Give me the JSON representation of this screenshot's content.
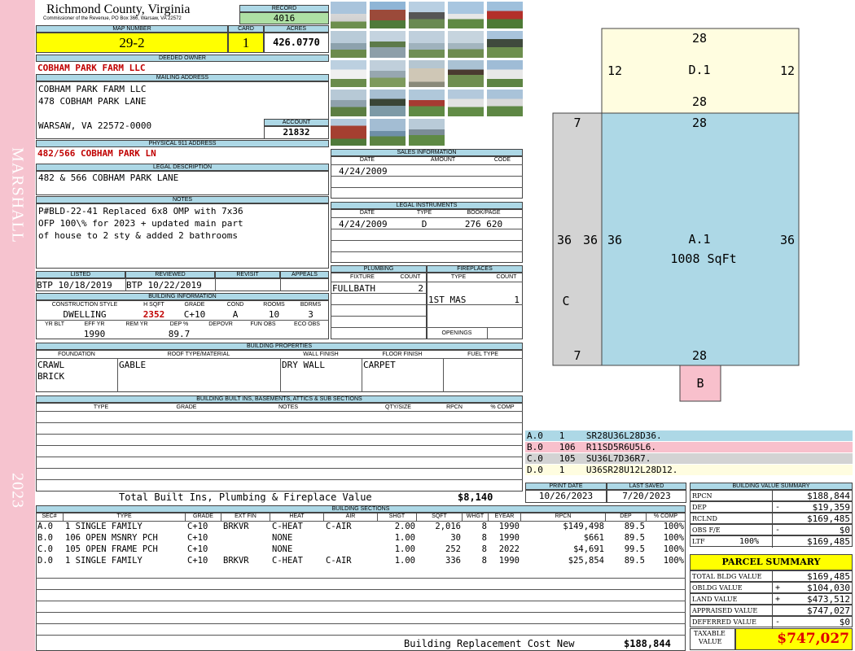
{
  "side": {
    "owner_name": "MARSHALL",
    "year": "2023"
  },
  "header": {
    "county": "Richmond County, Virginia",
    "address_line": "Commissioner of the Revenue, PO Box 366, Warsaw, VA 22572",
    "record_label": "RECORD",
    "record": "4016",
    "map_label": "MAP NUMBER",
    "map_number": "29-2",
    "card_label": "CARD",
    "card": "1",
    "acres_label": "ACRES",
    "acres": "426.0770"
  },
  "owner": {
    "deeded_label": "DEEDED OWNER",
    "deeded_owner": "COBHAM PARK FARM LLC",
    "mailing_label": "MAILING ADDRESS",
    "mailing_lines": [
      "COBHAM PARK FARM LLC",
      "478 COBHAM PARK LANE",
      "",
      "WARSAW, VA 22572-0000"
    ],
    "account_label": "ACCOUNT",
    "account": "21832",
    "physical_label": "PHYSICAL 911 ADDRESS",
    "physical_address": "482/566 COBHAM PARK LN",
    "legal_label": "LEGAL DESCRIPTION",
    "legal_description": "482 & 566 COBHAM PARK LANE",
    "notes_label": "NOTES",
    "notes_lines": [
      "P#BLD-22-41 Replaced 6x8 OMP with 7x36",
      "OFP 100\\% for 2023 + updated main part",
      "of house to 2 sty & added 2 bathrooms"
    ]
  },
  "status": {
    "listed_label": "LISTED",
    "listed": "BTP 10/18/2019",
    "reviewed_label": "REVIEWED",
    "reviewed": "BTP 10/22/2019",
    "revisit_label": "REVISIT",
    "appeals_label": "APPEALS"
  },
  "building_info": {
    "title": "BUILDING INFORMATION",
    "headers": [
      "CONSTRUCTION STYLE",
      "H SQFT",
      "GRADE",
      "COND",
      "ROOMS",
      "BDRMS"
    ],
    "values": [
      "DWELLING",
      "2352",
      "C+10",
      "A",
      "10",
      "3"
    ],
    "headers2": [
      "YR BLT",
      "EFF YR",
      "REM YR",
      "DEP %",
      "DEPOVR",
      "FUN OBS",
      "ECO OBS"
    ],
    "values2": [
      "",
      "1990",
      "",
      "89.7",
      "",
      "",
      ""
    ]
  },
  "sales": {
    "title": "SALES INFORMATION",
    "headers": [
      "DATE",
      "AMOUNT",
      "CODE"
    ],
    "rows": [
      [
        "4/24/2009",
        "",
        ""
      ]
    ]
  },
  "legal_instruments": {
    "title": "LEGAL INSTRUMENTS",
    "headers": [
      "DATE",
      "TYPE",
      "BOOK/PAGE"
    ],
    "rows": [
      [
        "4/24/2009",
        "D",
        "276 620"
      ]
    ]
  },
  "plumbing": {
    "title": "PLUMBING",
    "headers": [
      "FIXTURE",
      "COUNT"
    ],
    "rows": [
      [
        "FULLBATH",
        "2"
      ]
    ]
  },
  "fireplaces": {
    "title": "FIREPLACES",
    "headers": [
      "TYPE",
      "COUNT"
    ],
    "rows": [
      [
        "1ST MAS",
        "1"
      ]
    ],
    "openings_label": "OPENINGS"
  },
  "building_properties": {
    "title": "BUILDING PROPERTIES",
    "headers": [
      "FOUNDATION",
      "ROOF TYPE/MATERIAL",
      "WALL FINISH",
      "FLOOR FINISH",
      "FUEL TYPE"
    ],
    "foundation": [
      "CRAWL",
      "BRICK"
    ],
    "roof": "GABLE",
    "wall": "DRY WALL",
    "floor": "CARPET",
    "fuel": ""
  },
  "built_ins": {
    "title": "BUILDING BUILT INS, BASEMENTS, ATTICS & SUB SECTIONS",
    "headers": [
      "TYPE",
      "GRADE",
      "NOTES",
      "QTY/SIZE",
      "RPCN",
      "% COMP"
    ],
    "total_label": "Total Built Ins, Plumbing & Fireplace Value",
    "total_value": "$8,140"
  },
  "dates": {
    "print_label": "PRINT DATE",
    "print_date": "10/26/2023",
    "saved_label": "LAST SAVED",
    "last_saved": "7/20/2023"
  },
  "sketch": {
    "labels": [
      "28",
      "12",
      "D.1",
      "12",
      "28",
      "7",
      "28",
      "36",
      "36",
      "36",
      "A.1",
      "1008 SqFt",
      "36",
      "C",
      "7",
      "28",
      "B"
    ],
    "legend": [
      {
        "text": "A.0   1    SR28U36L28D36.",
        "color": "#add8e6"
      },
      {
        "text": "B.0   106  R11SD5R6U5L6.",
        "color": "#f8c0cc"
      },
      {
        "text": "C.0   105  SU36L7D36R7.",
        "color": "#d3d3d3"
      },
      {
        "text": "D.0   1    U36SR28U12L28D12.",
        "color": "#fffde0"
      }
    ]
  },
  "sections": {
    "title": "BUILDING SECTIONS",
    "headers": [
      "SEC#",
      "TYPE",
      "GRADE",
      "EXT FIN",
      "HEAT",
      "AIR",
      "SHGT",
      "SQFT",
      "WHGT",
      "EYEAR",
      "RPCN",
      "DEP",
      "% COMP"
    ],
    "rows": [
      [
        "A.0",
        "1 SINGLE FAMILY",
        "C+10",
        "BRKVR",
        "C-HEAT",
        "C-AIR",
        "2.00",
        "2,016",
        "8",
        "1990",
        "$149,498",
        "89.5",
        "100%"
      ],
      [
        "B.0",
        "106 OPEN MSNRY PCH",
        "C+10",
        "",
        "NONE",
        "",
        "1.00",
        "30",
        "8",
        "1990",
        "$661",
        "89.5",
        "100%"
      ],
      [
        "C.0",
        "105 OPEN FRAME PCH",
        "C+10",
        "",
        "NONE",
        "",
        "1.00",
        "252",
        "8",
        "2022",
        "$4,691",
        "99.5",
        "100%"
      ],
      [
        "D.0",
        "1 SINGLE FAMILY",
        "C+10",
        "BRKVR",
        "C-HEAT",
        "C-AIR",
        "1.00",
        "336",
        "8",
        "1990",
        "$25,854",
        "89.5",
        "100%"
      ]
    ],
    "rcn_label": "Building Replacement Cost New",
    "rcn_value": "$188,844"
  },
  "value_summary": {
    "title": "BUILDING VALUE SUMMARY",
    "rows": [
      {
        "label": "RPCN",
        "sign": "",
        "value": "$188,844"
      },
      {
        "label": "DEP",
        "sign": "-",
        "value": "$19,359"
      },
      {
        "label": "RCLND",
        "sign": "",
        "value": "$169,485"
      },
      {
        "label": "OBS F/E",
        "sign": "-",
        "value": "$0"
      },
      {
        "label": "LTF",
        "sign": "100%",
        "value": "$169,485"
      }
    ]
  },
  "parcel_summary": {
    "title": "PARCEL SUMMARY",
    "rows": [
      {
        "label": "TOTAL BLDG VALUE",
        "sign": "",
        "value": "$169,485"
      },
      {
        "label": "OBLDG VALUE",
        "sign": "+",
        "value": "$104,030"
      },
      {
        "label": "LAND VALUE",
        "sign": "+",
        "value": "$473,512"
      },
      {
        "label": "APPRAISED VALUE",
        "sign": "",
        "value": "$747,027"
      },
      {
        "label": "DEFERRED VALUE",
        "sign": "-",
        "value": "$0"
      }
    ],
    "taxable_label_1": "TAXABLE",
    "taxable_label_2": "VALUE",
    "taxable_value": "$747,027"
  }
}
